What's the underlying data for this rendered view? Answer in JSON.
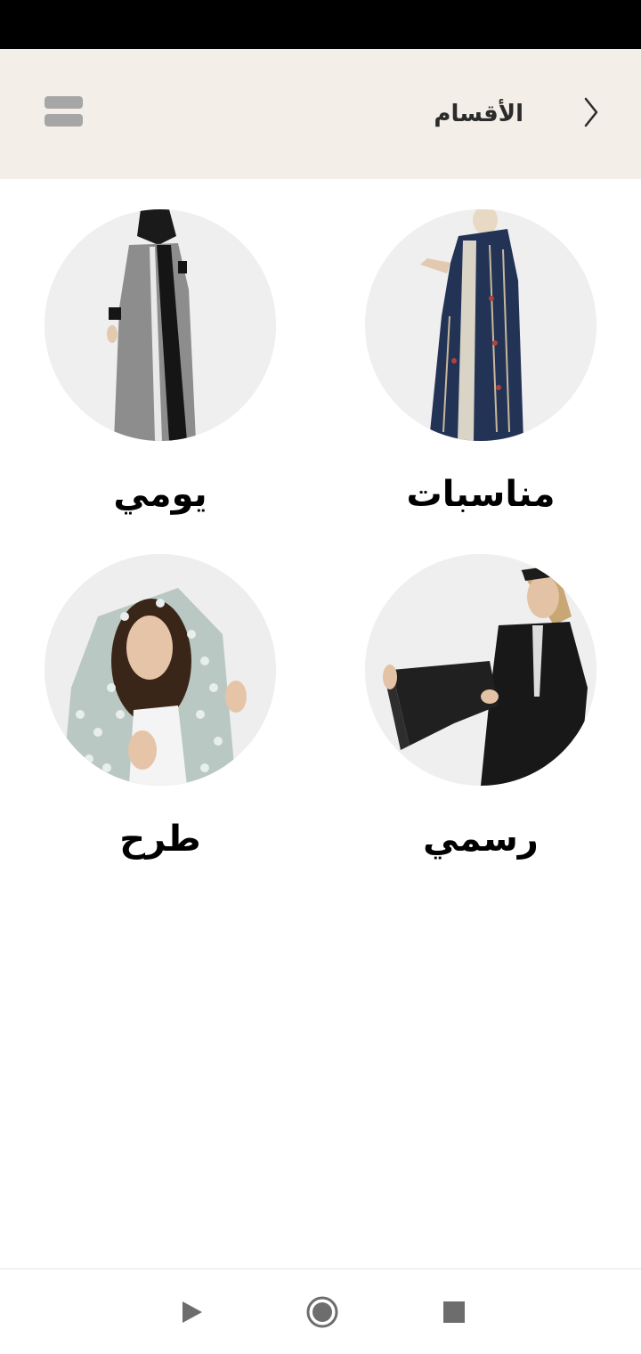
{
  "header": {
    "title": "الأقسام",
    "back_icon": "chevron-right-icon",
    "menu_icon": "menu-icon",
    "background": "#f3efe8"
  },
  "categories": [
    {
      "label": "مناسبات",
      "image": "navy-embroidered-abaya-photo"
    },
    {
      "label": "يومي",
      "image": "grey-black-abaya-photo"
    },
    {
      "label": "رسمي",
      "image": "black-formal-abaya-photo"
    },
    {
      "label": "طرح",
      "image": "sheer-polka-dot-scarf-photo"
    }
  ],
  "system_nav": {
    "back_icon": "triangle-back-icon",
    "home_icon": "circle-home-icon",
    "recents_icon": "square-recents-icon"
  }
}
